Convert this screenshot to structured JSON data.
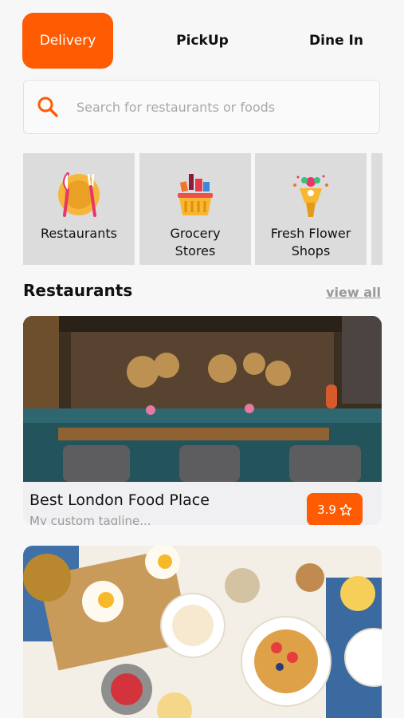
{
  "tabs": [
    {
      "label": "Delivery",
      "active": true
    },
    {
      "label": "PickUp",
      "active": false
    },
    {
      "label": "Dine In",
      "active": false
    }
  ],
  "search": {
    "placeholder": "Search for restaurants or foods",
    "icon": "search-icon"
  },
  "categories": [
    {
      "label": "Restaurants",
      "icon": "restaurant-plate-icon"
    },
    {
      "label": "Grocery\nStores",
      "icon": "grocery-basket-icon"
    },
    {
      "label": "Fresh Flower\nShops",
      "icon": "flower-bouquet-icon"
    }
  ],
  "section": {
    "title": "Restaurants",
    "view_all": "view all"
  },
  "restaurants": [
    {
      "name": "Best London Food Place",
      "tagline": "My custom tagline...",
      "rating": "3.9"
    }
  ],
  "colors": {
    "accent": "#fe5b02",
    "tile": "#dcdcdc"
  }
}
